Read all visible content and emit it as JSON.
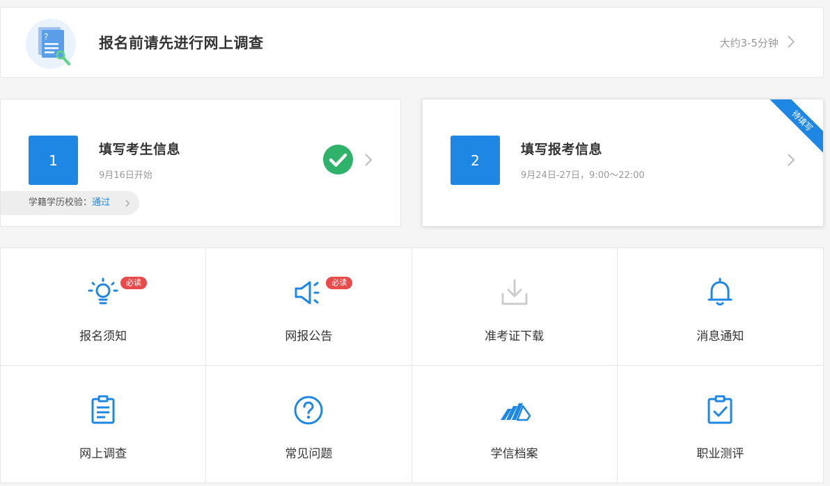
{
  "survey": {
    "title": "报名前请先进行网上调查",
    "duration": "大约3-5分钟"
  },
  "steps": [
    {
      "number": "1",
      "title": "填写考生信息",
      "date": "9月16日开始",
      "status": "completed",
      "verify_label": "学籍学历校验：",
      "verify_value": "通过"
    },
    {
      "number": "2",
      "title": "填写报考信息",
      "date": "9月24日-27日，9:00～22:00",
      "ribbon": "待填写"
    }
  ],
  "menu": [
    {
      "label": "报名须知",
      "icon": "lightbulb-icon",
      "badge": "必读"
    },
    {
      "label": "网报公告",
      "icon": "megaphone-icon",
      "badge": "必读"
    },
    {
      "label": "准考证下载",
      "icon": "download-icon",
      "disabled": true
    },
    {
      "label": "消息通知",
      "icon": "bell-icon"
    },
    {
      "label": "网上调查",
      "icon": "clipboard-icon"
    },
    {
      "label": "常见问题",
      "icon": "question-icon"
    },
    {
      "label": "学信档案",
      "icon": "archive-icon"
    },
    {
      "label": "职业测评",
      "icon": "clipboard-check-icon"
    }
  ],
  "colors": {
    "accent": "#1e87e4",
    "success": "#2fb36b",
    "badge": "#e94b4b",
    "disabled_icon": "#cccccc"
  }
}
